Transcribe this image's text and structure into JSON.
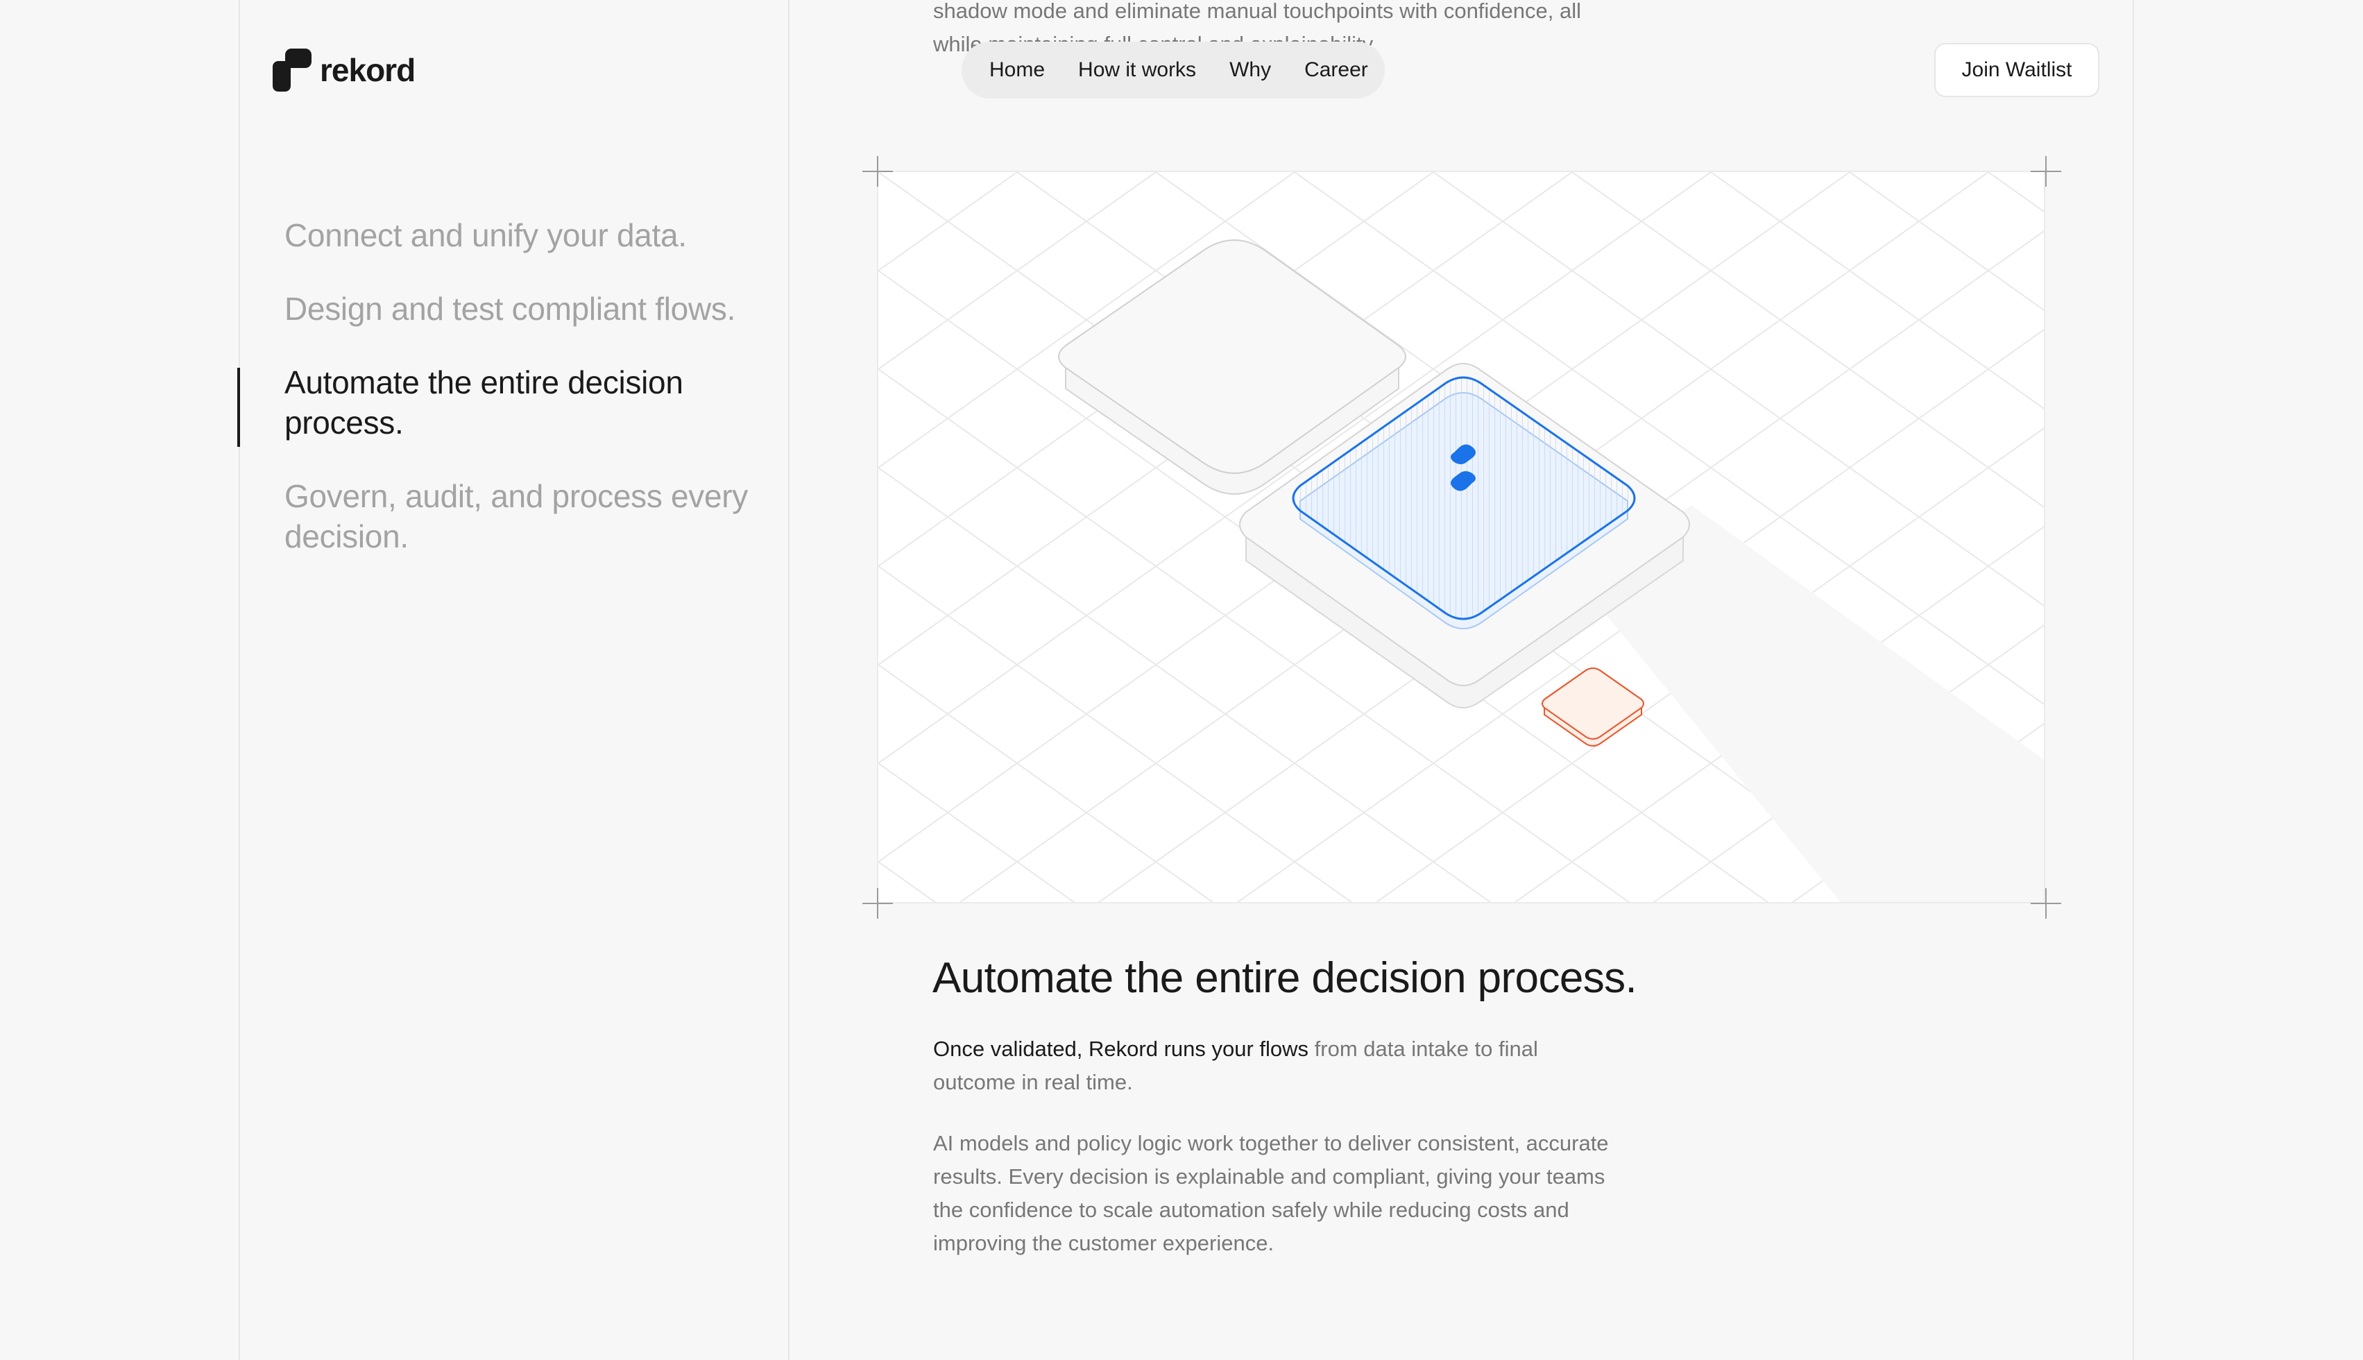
{
  "brand": {
    "name": "rekord"
  },
  "nav": {
    "items": [
      "Home",
      "How it works",
      "Why",
      "Career"
    ],
    "cta": "Join Waitlist"
  },
  "sidebar": {
    "steps": [
      {
        "label": "Connect and unify your data.",
        "active": false
      },
      {
        "label": "Design and test compliant flows.",
        "active": false
      },
      {
        "label": "Automate the entire decision process.",
        "active": true
      },
      {
        "label": "Govern, audit, and process every decision.",
        "active": false
      }
    ]
  },
  "main": {
    "faded_previous_text": "shadow mode and eliminate manual touchpoints with confidence, all while maintaining full control and explainability.",
    "heading": "Automate the entire decision process.",
    "para1_strong": "Once validated, Rekord runs your flows",
    "para1_rest": " from data intake to final outcome in real time.",
    "para2": "AI models and policy logic work together to deliver consistent, accurate results. Every decision is explainable and compliant, giving your teams the confidence to scale automation safely while reducing costs and improving the customer experience."
  },
  "colors": {
    "accent": "#1a73e8",
    "warning": "#e8572c",
    "text": "#1a1a1a",
    "muted": "#777777"
  },
  "icons": [
    "rekord-logo-icon",
    "rekord-brand-icon"
  ]
}
